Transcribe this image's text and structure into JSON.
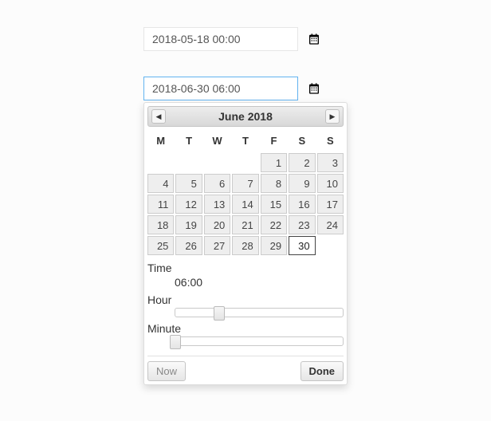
{
  "field1": {
    "value": "2018-05-18 00:00"
  },
  "field2": {
    "value": "2018-06-30 06:00"
  },
  "picker": {
    "title": "June 2018",
    "dow": [
      "M",
      "T",
      "W",
      "T",
      "F",
      "S",
      "S"
    ],
    "weeks": [
      [
        null,
        null,
        null,
        null,
        1,
        2,
        3
      ],
      [
        4,
        5,
        6,
        7,
        8,
        9,
        10
      ],
      [
        11,
        12,
        13,
        14,
        15,
        16,
        17
      ],
      [
        18,
        19,
        20,
        21,
        22,
        23,
        24
      ],
      [
        25,
        26,
        27,
        28,
        29,
        30,
        null
      ]
    ],
    "selected": 30,
    "time": {
      "label": "Time",
      "value": "06:00"
    },
    "hour": {
      "label": "Hour",
      "value": 6,
      "max": 23
    },
    "minute": {
      "label": "Minute",
      "value": 0,
      "max": 59
    },
    "now_label": "Now",
    "done_label": "Done"
  }
}
